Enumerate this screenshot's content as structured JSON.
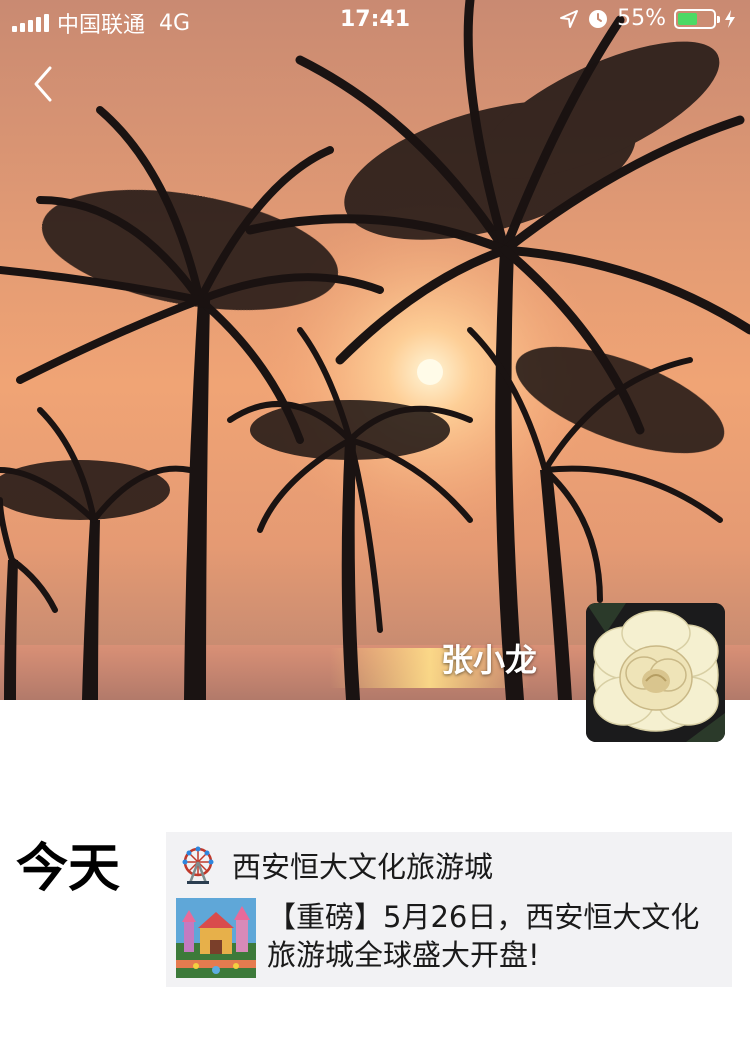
{
  "status_bar": {
    "carrier": "中国联通",
    "network": "4G",
    "time": "17:41",
    "battery_percent": "55%",
    "battery_level": 0.55,
    "icons": [
      "signal-icon",
      "location-icon",
      "alarm-icon",
      "battery-icon",
      "charging-icon"
    ]
  },
  "profile": {
    "name": "张小龙",
    "cover_image": "sunset-palm-trees",
    "avatar_image": "white-rose"
  },
  "timeline": {
    "day_label": "今天",
    "posts": [
      {
        "author": "西安恒大文化旅游城",
        "author_icon": "ferris-wheel-icon",
        "thumbnail": "theme-park-thumbnail",
        "text": "【重磅】5月26日，西安恒大文化旅游城全球盛大开盘!"
      }
    ]
  },
  "colors": {
    "battery_fill": "#4cd964",
    "post_background": "#f2f2f4",
    "sky_sunset": "#f0a475"
  }
}
